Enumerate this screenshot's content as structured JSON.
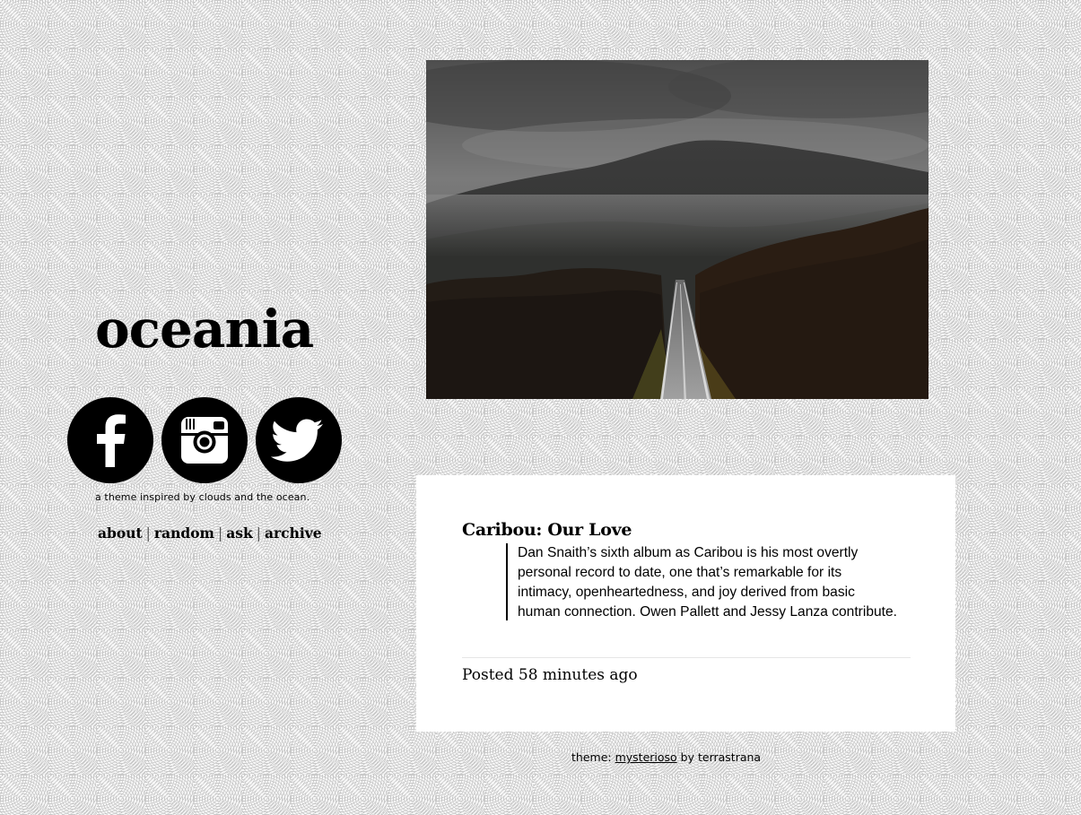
{
  "blog": {
    "title": "oceania",
    "tagline": "a theme inspired by clouds and the ocean.",
    "social": [
      "facebook-icon",
      "instagram-icon",
      "twitter-icon"
    ],
    "nav": {
      "about": "about",
      "random": "random",
      "ask": "ask",
      "archive": "archive",
      "separator": "|"
    }
  },
  "post": {
    "image": "misty-mountain-road-photo",
    "title": "Caribou: Our Love",
    "quote": "Dan Snaith’s sixth album as Caribou is his most overtly\npersonal record to date, one that’s remarkable for its\nintimacy, openheartedness, and joy derived from basic\nhuman connection. Owen Pallett and Jessy Lanza contribute.",
    "posted": "Posted 58 minutes ago"
  },
  "footer": {
    "prefix": "theme:",
    "theme_link": "mysterioso",
    "suffix": "by terrastrana"
  },
  "colors": {
    "text": "#000000",
    "card_background": "#ffffff",
    "page_background": "#f7f7f7",
    "pattern": "#c9c9c9"
  }
}
